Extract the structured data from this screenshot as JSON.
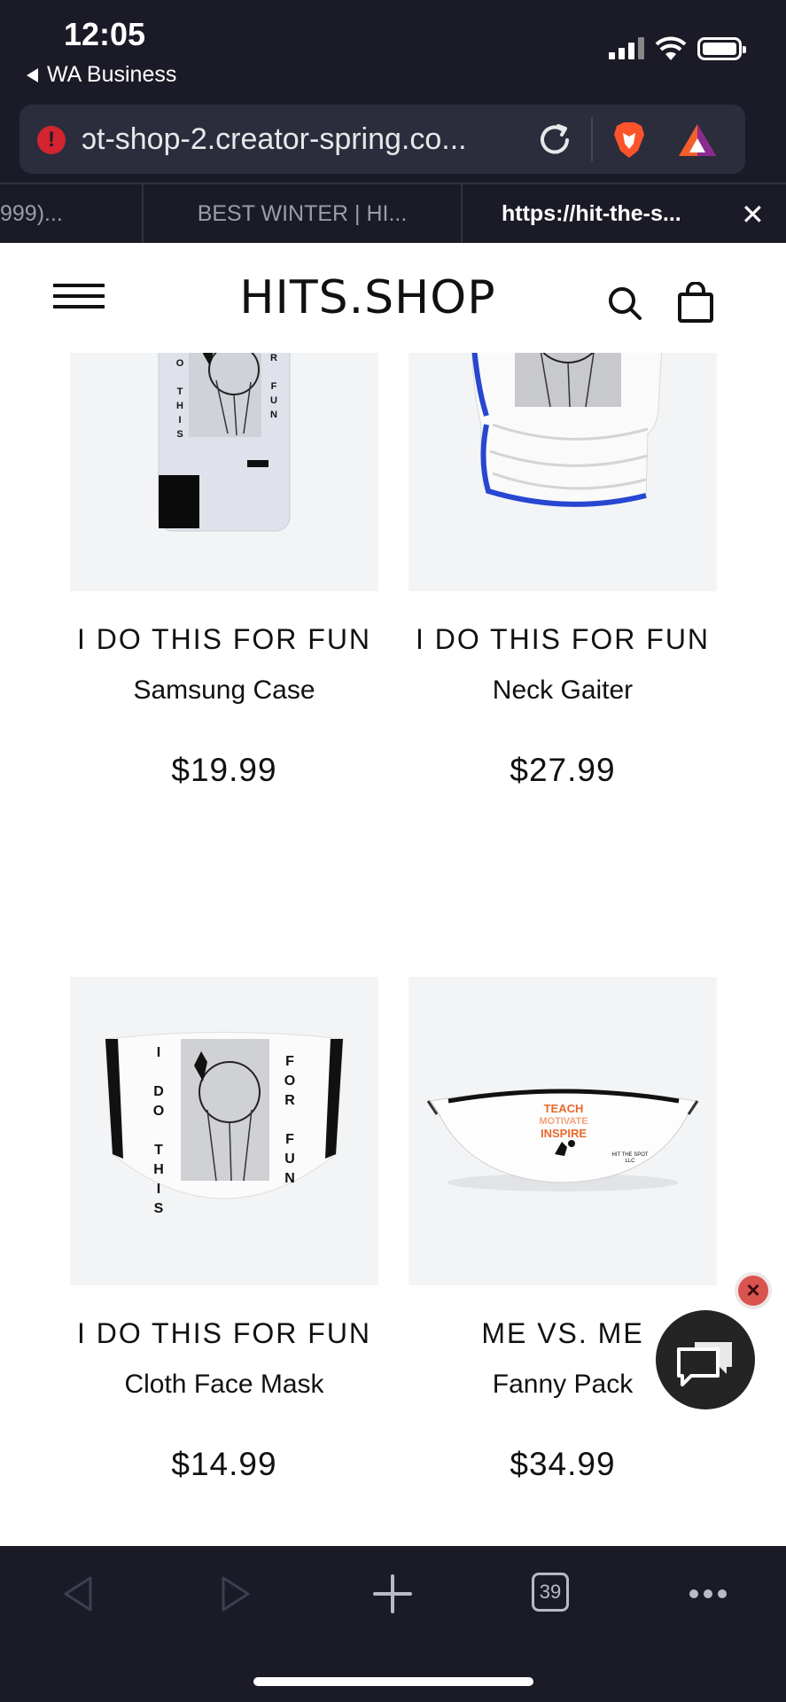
{
  "status_bar": {
    "time": "12:05",
    "back_app": "WA Business"
  },
  "browser": {
    "url": "ɔt-shop-2.creator-spring.co...",
    "tabs": [
      {
        "label": "999)..."
      },
      {
        "label": "BEST WINTER | HI..."
      },
      {
        "label": "https://hit-the-s..."
      }
    ],
    "tab_count": "39"
  },
  "site": {
    "logo": "HITS.SHOP"
  },
  "products": [
    {
      "design": "I DO THIS FOR FUN",
      "type": "Samsung Case",
      "price": "$19.99"
    },
    {
      "design": "I DO THIS FOR FUN",
      "type": "Neck Gaiter",
      "price": "$27.99"
    },
    {
      "design": "I DO THIS FOR FUN",
      "type": "Cloth Face Mask",
      "price": "$14.99"
    },
    {
      "design": "ME VS. ME",
      "type": "Fanny Pack",
      "price": "$34.99"
    }
  ],
  "product_art": {
    "case_left_text": "I DO THIS",
    "case_right_text": "FOR FUN",
    "mask_left_text": "I DO THIS",
    "mask_right_text": "FOR FUN",
    "fanny_line1": "TEACH",
    "fanny_line2": "MOTIVATE",
    "fanny_line3": "INSPIRE",
    "fanny_brand": "HIT THE SPOT LLC"
  },
  "colors": {
    "accent_orange": "#e8692b",
    "chrome_bg": "#1a1b26",
    "brave_orange": "#fb542b",
    "error_red": "#d3242f"
  }
}
